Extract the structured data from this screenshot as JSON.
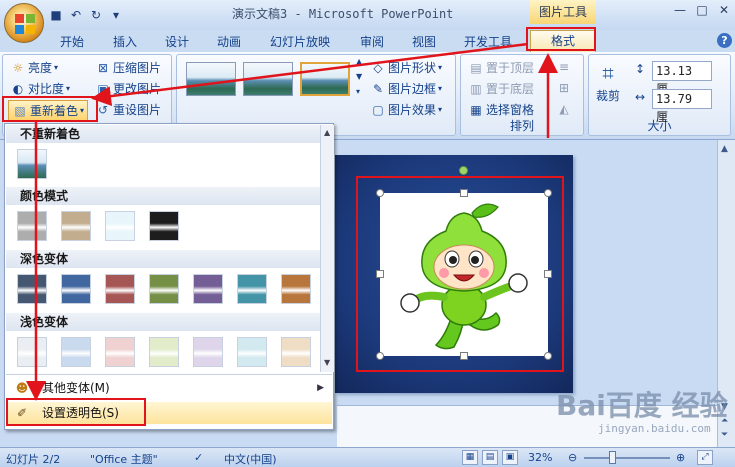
{
  "titlebar": {
    "title": "演示文稿3 - Microsoft PowerPoint",
    "context_title": "图片工具",
    "qat": [
      "save-icon",
      "undo-icon",
      "redo-icon",
      "customize-icon"
    ],
    "qat_glyphs": [
      "■",
      "↶",
      "↻",
      "▾"
    ],
    "window_controls": [
      "—",
      "□",
      "✕"
    ]
  },
  "tabs": [
    "开始",
    "插入",
    "设计",
    "动画",
    "幻灯片放映",
    "审阅",
    "视图",
    "开发工具"
  ],
  "format_tab": "格式",
  "help": "?",
  "ribbon": {
    "adjust": {
      "brightness": "亮度",
      "contrast": "对比度",
      "recolor": "重新着色",
      "compress": "压缩图片",
      "change": "更改图片",
      "reset": "重设图片"
    },
    "styles": {
      "shape": "图片形状",
      "border": "图片边框",
      "effects": "图片效果"
    },
    "arrange": {
      "bring_front": "置于顶层",
      "send_back": "置于底层",
      "selection_pane": "选择窗格",
      "label": "排列"
    },
    "size": {
      "crop": "裁剪",
      "height": "13.13 厘",
      "width": "13.79 厘",
      "label": "大小"
    }
  },
  "recolor_menu": {
    "no_recolor": "不重新着色",
    "color_modes": "颜色模式",
    "dark_variations": "深色变体",
    "light_variations": "浅色变体",
    "more_variations": "其他变体(M)",
    "set_transparent": "设置透明色(S)",
    "color_mode_swatches": [
      "#a9a9a9",
      "#bfa98a",
      "#e7f6fb",
      "#111111"
    ],
    "dark_swatches": [
      "#3c4f6a",
      "#375f9c",
      "#a34d4d",
      "#6f8a3e",
      "#6d5691",
      "#3a8fa3",
      "#b56f32"
    ],
    "light_swatches": [
      "#e9edf2",
      "#c7d7ee",
      "#efcfcf",
      "#e1ecc9",
      "#ddd3ea",
      "#cfe8ef",
      "#f0dcc4"
    ]
  },
  "statusbar": {
    "slide": "幻灯片 2/2",
    "theme": "\"Office 主题\"",
    "language": "中文(中国)",
    "zoom": "32%",
    "zoom_fraction": 0.32
  },
  "watermark": {
    "main": "Bai百度 经验",
    "sub": "jingyan.baidu.com"
  }
}
